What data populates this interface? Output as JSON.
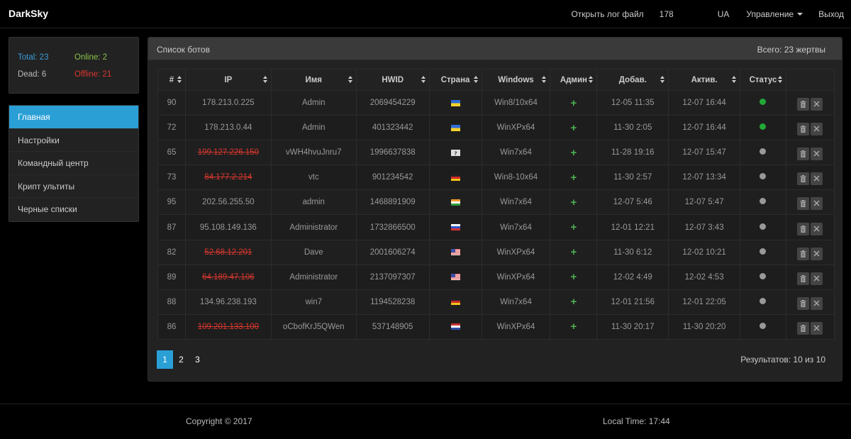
{
  "brand": "DarkSky",
  "nav": {
    "open_log": "Открыть лог файл",
    "ip_prefix": "178",
    "country": "UA",
    "manage": "Управление",
    "logout": "Выход"
  },
  "stats": {
    "total": "Total: 23",
    "online": "Online: 2",
    "dead": "Dead: 6",
    "offline": "Offline: 21",
    "colors": {
      "total": "#3a9ad9",
      "online": "#8bc34a",
      "offline": "#d9372f"
    }
  },
  "menu": [
    {
      "label": "Главная",
      "active": true
    },
    {
      "label": "Настройки",
      "active": false
    },
    {
      "label": "Командный центр",
      "active": false
    },
    {
      "label": "Крипт ультиты",
      "active": false
    },
    {
      "label": "Черные списки",
      "active": false
    }
  ],
  "panel": {
    "title": "Список ботов",
    "count": "Всего: 23 жертвы"
  },
  "table": {
    "headers": [
      "#",
      "IP",
      "Имя",
      "HWID",
      "Страна",
      "Windows",
      "Админ",
      "Добав.",
      "Актив.",
      "Статус",
      ""
    ],
    "rows": [
      {
        "id": "90",
        "ip": "178.213.0.225",
        "dead": false,
        "name": "Admin",
        "hwid": "2069454229",
        "flag": "ua",
        "windows": "Win8/10x64",
        "admin": "+",
        "added": "12-05 11:35",
        "active": "12-07 16:44",
        "online": true
      },
      {
        "id": "72",
        "ip": "178.213.0.44",
        "dead": false,
        "name": "Admin",
        "hwid": "401323442",
        "flag": "ua",
        "windows": "WinXPx64",
        "admin": "+",
        "added": "11-30 2:05",
        "active": "12-07 16:44",
        "online": true
      },
      {
        "id": "65",
        "ip": "199.127.226.150",
        "dead": true,
        "name": "vWH4hvuJnru7",
        "hwid": "1996637838",
        "flag": "unknown",
        "windows": "Win7x64",
        "admin": "+",
        "added": "11-28 19:16",
        "active": "12-07 15:47",
        "online": false
      },
      {
        "id": "73",
        "ip": "84.177.2.214",
        "dead": true,
        "name": "vtc",
        "hwid": "901234542",
        "flag": "de",
        "windows": "Win8-10x64",
        "admin": "+",
        "added": "11-30 2:57",
        "active": "12-07 13:34",
        "online": false
      },
      {
        "id": "95",
        "ip": "202.56.255.50",
        "dead": false,
        "name": "admin",
        "hwid": "1468891909",
        "flag": "in",
        "windows": "Win7x64",
        "admin": "+",
        "added": "12-07 5:46",
        "active": "12-07 5:47",
        "online": false
      },
      {
        "id": "87",
        "ip": "95.108.149.136",
        "dead": false,
        "name": "Administrator",
        "hwid": "1732866500",
        "flag": "ru",
        "windows": "Win7x64",
        "admin": "+",
        "added": "12-01 12:21",
        "active": "12-07 3:43",
        "online": false
      },
      {
        "id": "82",
        "ip": "52.68.12.201",
        "dead": true,
        "name": "Dave",
        "hwid": "2001606274",
        "flag": "us",
        "windows": "WinXPx64",
        "admin": "+",
        "added": "11-30 6:12",
        "active": "12-02 10:21",
        "online": false
      },
      {
        "id": "89",
        "ip": "64.189.47.106",
        "dead": true,
        "name": "Administrator",
        "hwid": "2137097307",
        "flag": "us",
        "windows": "WinXPx64",
        "admin": "+",
        "added": "12-02 4:49",
        "active": "12-02 4:53",
        "online": false
      },
      {
        "id": "88",
        "ip": "134.96.238.193",
        "dead": false,
        "name": "win7",
        "hwid": "1194528238",
        "flag": "de",
        "windows": "Win7x64",
        "admin": "+",
        "added": "12-01 21:56",
        "active": "12-01 22:05",
        "online": false
      },
      {
        "id": "86",
        "ip": "109.201.133.100",
        "dead": true,
        "name": "oCbofKrJ5QWen",
        "hwid": "537148905",
        "flag": "nl",
        "windows": "WinXPx64",
        "admin": "+",
        "added": "11-30 20:17",
        "active": "11-30 20:20",
        "online": false
      }
    ]
  },
  "pagination": {
    "pages": [
      "1",
      "2",
      "3"
    ],
    "active": 0,
    "results": "Результатов: 10 из 10"
  },
  "footer": {
    "copyright": "Copyright © 2017",
    "local_time": "Local Time: 17:44"
  },
  "colors": {
    "accent": "#2a9fd6",
    "dead_ip": "#d9372f",
    "online_dot": "#22a837",
    "offline_dot": "#999999",
    "admin_plus": "#4caf50"
  }
}
